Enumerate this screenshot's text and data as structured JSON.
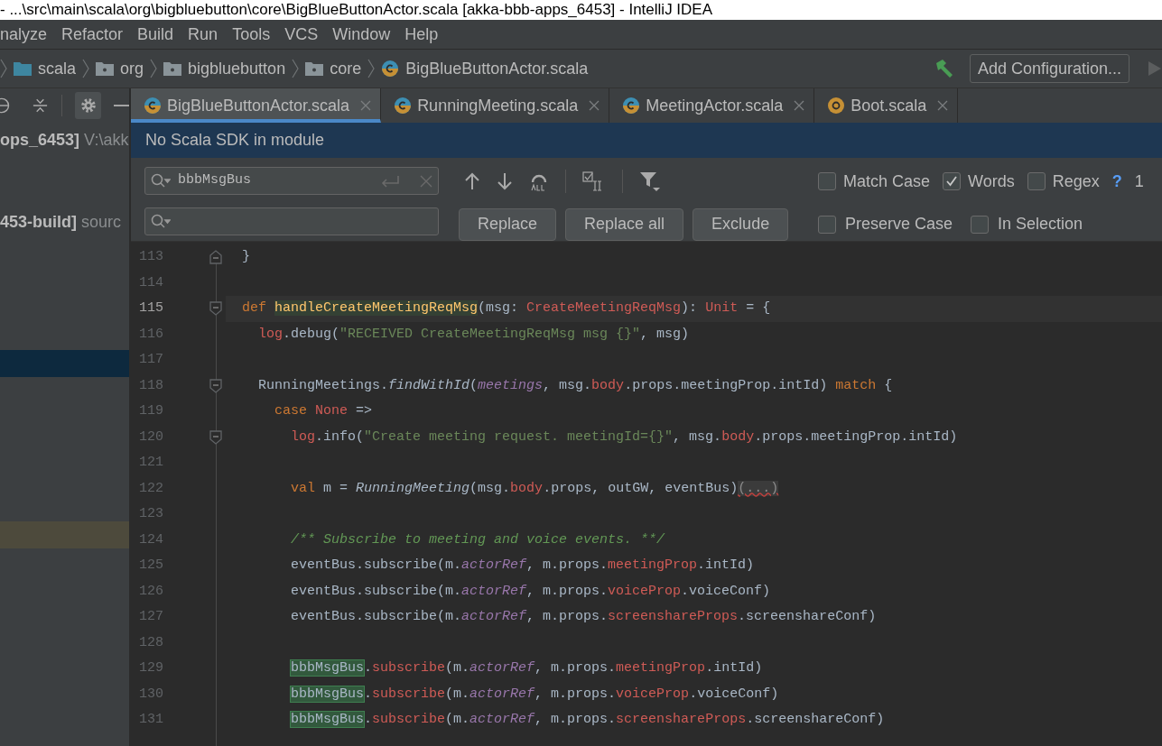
{
  "window": {
    "title": "- ...\\src\\main\\scala\\org\\bigbluebutton\\core\\BigBlueButtonActor.scala [akka-bbb-apps_6453] - IntelliJ IDEA"
  },
  "menu": [
    "nalyze",
    "Refactor",
    "Build",
    "Run",
    "Tools",
    "VCS",
    "Window",
    "Help"
  ],
  "breadcrumbs": [
    {
      "label": "scala",
      "kind": "source-folder"
    },
    {
      "label": "org",
      "kind": "folder"
    },
    {
      "label": "bigbluebutton",
      "kind": "folder"
    },
    {
      "label": "core",
      "kind": "folder"
    },
    {
      "label": "BigBlueButtonActor.scala",
      "kind": "class"
    }
  ],
  "run_config": {
    "label": "Add Configuration..."
  },
  "tabs": [
    {
      "label": "BigBlueButtonActor.scala",
      "kind": "class",
      "selected": true
    },
    {
      "label": "RunningMeeting.scala",
      "kind": "class",
      "selected": false
    },
    {
      "label": "MeetingActor.scala",
      "kind": "class",
      "selected": false
    },
    {
      "label": "Boot.scala",
      "kind": "object",
      "selected": false
    }
  ],
  "project_tree": [
    {
      "kind": "text",
      "text": "**ops_6453]** V:\\akk"
    },
    {
      "kind": "text",
      "text": "**453-build]** sourc"
    },
    {
      "kind": "selected"
    },
    {
      "kind": "marked"
    }
  ],
  "banner": "No Scala SDK in module",
  "find": {
    "search_value": "bbbMsgBus",
    "options": [
      {
        "label": "Match Case",
        "checked": false
      },
      {
        "label": "Words",
        "checked": true
      },
      {
        "label": "Regex",
        "checked": false
      }
    ],
    "help": "?",
    "count": "1",
    "buttons": [
      "Replace",
      "Replace all",
      "Exclude"
    ],
    "options2": [
      {
        "label": "Preserve Case",
        "checked": false
      },
      {
        "label": "In Selection",
        "checked": false
      }
    ]
  },
  "code": [
    {
      "number": "113",
      "fold": {
        "kind": "end"
      },
      "current": false,
      "tokens": [
        {
          "t": "}",
          "kind": "plain"
        }
      ]
    },
    {
      "number": "114",
      "current": false
    },
    {
      "number": "115",
      "fold": {
        "kind": "start"
      },
      "current": true,
      "tokens": [
        {
          "t": "def ",
          "kind": "keyword"
        },
        {
          "t": "handleCreateMeetingReqMsg",
          "kind": "decl"
        },
        {
          "t": "(msg: ",
          "kind": "plain"
        },
        {
          "t": "CreateMeetingReqMsg",
          "kind": "error"
        },
        {
          "t": "): ",
          "kind": "plain"
        },
        {
          "t": "Unit",
          "kind": "error"
        },
        {
          "t": " = {",
          "kind": "plain"
        }
      ]
    },
    {
      "number": "116",
      "current": false,
      "tokens": [
        {
          "t": "  log",
          "kind": "error"
        },
        {
          "t": ".debug(",
          "kind": "plain"
        },
        {
          "t": "\"RECEIVED CreateMeetingReqMsg msg {}\"",
          "kind": "string"
        },
        {
          "t": ", msg)",
          "kind": "plain"
        }
      ]
    },
    {
      "number": "117",
      "current": false
    },
    {
      "number": "118",
      "fold": {
        "kind": "start"
      },
      "current": false,
      "tokens": [
        {
          "t": "  RunningMeetings.",
          "kind": "plain"
        },
        {
          "t": "findWithId",
          "kind": "italic"
        },
        {
          "t": "(",
          "kind": "plain"
        },
        {
          "t": "meetings",
          "kind": "field"
        },
        {
          "t": ", msg.",
          "kind": "plain"
        },
        {
          "t": "body",
          "kind": "error"
        },
        {
          "t": ".props.meetingProp.intId) ",
          "kind": "plain"
        },
        {
          "t": "match",
          "kind": "keyword"
        },
        {
          "t": " {",
          "kind": "plain"
        }
      ]
    },
    {
      "number": "119",
      "current": false,
      "tokens": [
        {
          "t": "    case ",
          "kind": "keyword"
        },
        {
          "t": "None",
          "kind": "error"
        },
        {
          "t": " =>",
          "kind": "plain"
        }
      ]
    },
    {
      "number": "120",
      "fold": {
        "kind": "start"
      },
      "current": false,
      "tokens": [
        {
          "t": "      log",
          "kind": "error"
        },
        {
          "t": ".info(",
          "kind": "plain"
        },
        {
          "t": "\"Create meeting request. meetingId={}\"",
          "kind": "string"
        },
        {
          "t": ", msg.",
          "kind": "plain"
        },
        {
          "t": "body",
          "kind": "error"
        },
        {
          "t": ".props.meetingProp.intId)",
          "kind": "plain"
        }
      ]
    },
    {
      "number": "121",
      "current": false
    },
    {
      "number": "122",
      "current": false,
      "tokens": [
        {
          "t": "      val",
          "kind": "keyword"
        },
        {
          "t": " m = ",
          "kind": "plain"
        },
        {
          "t": "RunningMeeting",
          "kind": "italic"
        },
        {
          "t": "(msg.",
          "kind": "plain"
        },
        {
          "t": "body",
          "kind": "error"
        },
        {
          "t": ".props, outGW, eventBus)",
          "kind": "plain"
        },
        {
          "t": "(...)",
          "kind": "folded"
        }
      ]
    },
    {
      "number": "123",
      "current": false
    },
    {
      "number": "124",
      "current": false,
      "tokens": [
        {
          "t": "      /** Subscribe to meeting and voice events. **/",
          "kind": "comment"
        }
      ]
    },
    {
      "number": "125",
      "current": false,
      "tokens": [
        {
          "t": "      eventBus.subscribe(m.",
          "kind": "plain"
        },
        {
          "t": "actorRef",
          "kind": "field"
        },
        {
          "t": ", m.props.",
          "kind": "plain"
        },
        {
          "t": "meetingProp",
          "kind": "error"
        },
        {
          "t": ".intId)",
          "kind": "plain"
        }
      ]
    },
    {
      "number": "126",
      "current": false,
      "tokens": [
        {
          "t": "      eventBus.subscribe(m.",
          "kind": "plain"
        },
        {
          "t": "actorRef",
          "kind": "field"
        },
        {
          "t": ", m.props.",
          "kind": "plain"
        },
        {
          "t": "voiceProp",
          "kind": "error"
        },
        {
          "t": ".voiceConf)",
          "kind": "plain"
        }
      ]
    },
    {
      "number": "127",
      "current": false,
      "tokens": [
        {
          "t": "      eventBus.subscribe(m.",
          "kind": "plain"
        },
        {
          "t": "actorRef",
          "kind": "field"
        },
        {
          "t": ", m.props.",
          "kind": "plain"
        },
        {
          "t": "screenshareProps",
          "kind": "error"
        },
        {
          "t": ".screenshareConf)",
          "kind": "plain"
        }
      ]
    },
    {
      "number": "128",
      "current": false
    },
    {
      "number": "129",
      "current": false,
      "tokens": [
        {
          "t": "      bbbMsgBus",
          "kind": "match"
        },
        {
          "t": ".",
          "kind": "plain"
        },
        {
          "t": "subscribe",
          "kind": "error"
        },
        {
          "t": "(m.",
          "kind": "plain"
        },
        {
          "t": "actorRef",
          "kind": "field"
        },
        {
          "t": ", m.props.",
          "kind": "plain"
        },
        {
          "t": "meetingProp",
          "kind": "error"
        },
        {
          "t": ".intId)",
          "kind": "plain"
        }
      ]
    },
    {
      "number": "130",
      "current": false,
      "tokens": [
        {
          "t": "      bbbMsgBus",
          "kind": "match"
        },
        {
          "t": ".",
          "kind": "plain"
        },
        {
          "t": "subscribe",
          "kind": "error"
        },
        {
          "t": "(m.",
          "kind": "plain"
        },
        {
          "t": "actorRef",
          "kind": "field"
        },
        {
          "t": ", m.props.",
          "kind": "plain"
        },
        {
          "t": "voiceProp",
          "kind": "error"
        },
        {
          "t": ".voiceConf)",
          "kind": "plain"
        }
      ]
    },
    {
      "number": "131",
      "current": false,
      "tokens": [
        {
          "t": "      bbbMsgBus",
          "kind": "match"
        },
        {
          "t": ".",
          "kind": "plain"
        },
        {
          "t": "subscribe",
          "kind": "error"
        },
        {
          "t": "(m.",
          "kind": "plain"
        },
        {
          "t": "actorRef",
          "kind": "field"
        },
        {
          "t": ", m.props.",
          "kind": "plain"
        },
        {
          "t": "screenshareProps",
          "kind": "error"
        },
        {
          "t": ".screenshareConf)",
          "kind": "plain"
        }
      ]
    }
  ]
}
